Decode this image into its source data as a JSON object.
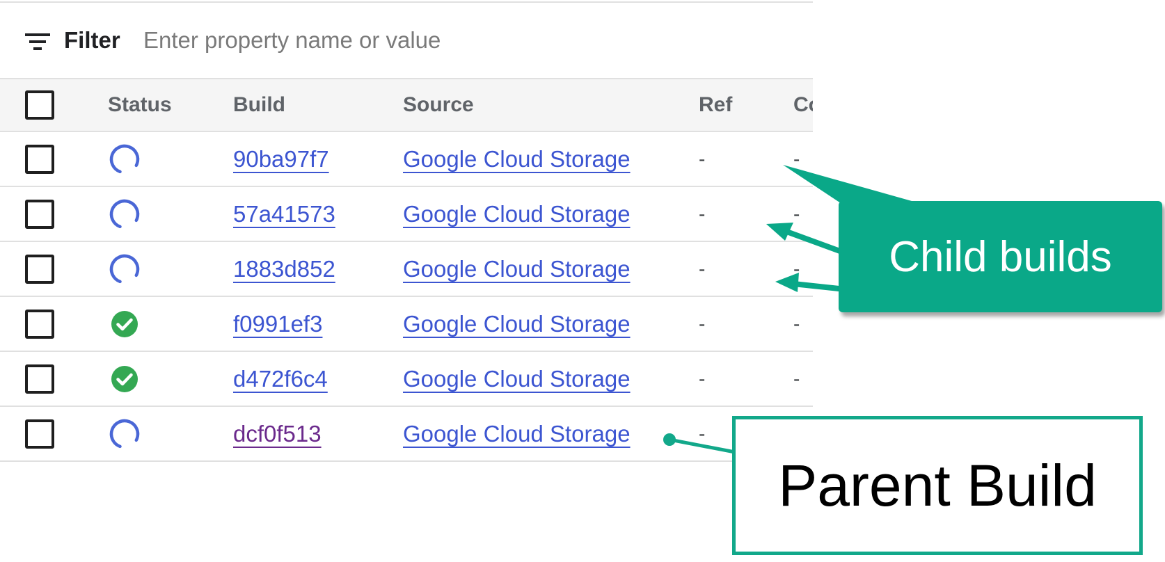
{
  "filter": {
    "label": "Filter",
    "placeholder": "Enter property name or value",
    "value": ""
  },
  "table": {
    "columns": [
      "Status",
      "Build",
      "Source",
      "Ref",
      "Co"
    ],
    "rows": [
      {
        "status": "running",
        "build": "90ba97f7",
        "source": "Google Cloud Storage",
        "ref": "-",
        "co": "-"
      },
      {
        "status": "running",
        "build": "57a41573",
        "source": "Google Cloud Storage",
        "ref": "-",
        "co": "-"
      },
      {
        "status": "running",
        "build": "1883d852",
        "source": "Google Cloud Storage",
        "ref": "-",
        "co": "-"
      },
      {
        "status": "success",
        "build": "f0991ef3",
        "source": "Google Cloud Storage",
        "ref": "-",
        "co": "-"
      },
      {
        "status": "success",
        "build": "d472f6c4",
        "source": "Google Cloud Storage",
        "ref": "-",
        "co": "-"
      },
      {
        "status": "running",
        "build": "dcf0f513",
        "source": "Google Cloud Storage",
        "ref": "-",
        "co": "-"
      }
    ]
  },
  "annotations": {
    "child_builds": "Child builds",
    "parent_build": "Parent Build"
  },
  "icons": {
    "filter": "filter-list-icon",
    "running": "spinner-icon",
    "success": "check-circle-icon"
  },
  "colors": {
    "link": "#3c55d1",
    "visited_link": "#6b2a8c",
    "spinner": "#4a67d6",
    "success": "#34a853",
    "callout": "#0aa888"
  }
}
